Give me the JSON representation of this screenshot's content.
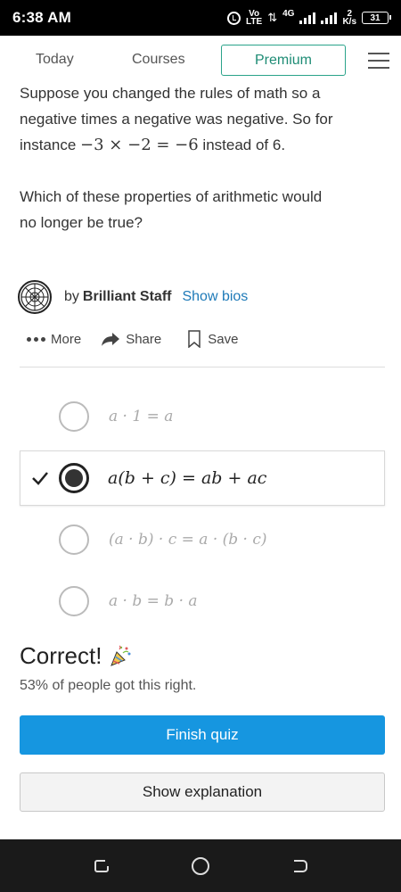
{
  "status_bar": {
    "time": "6:38 AM",
    "network_top": "Vo",
    "network_bottom": "LTE",
    "signal_type": "4G",
    "speed_value": "2",
    "speed_unit": "K/s",
    "battery": "31"
  },
  "nav": {
    "tabs": [
      "Today",
      "Courses"
    ],
    "premium_label": "Premium"
  },
  "question": {
    "line1": "Suppose you changed the rules of math so a",
    "line2": "negative times a negative was negative. So for",
    "line3_prefix": "instance ",
    "line3_math": "−3 × −2 = −6",
    "line3_suffix": " instead of 6.",
    "prompt_line1": "Which of these properties of arithmetic would",
    "prompt_line2": "no longer be true?"
  },
  "author": {
    "by_label": "by",
    "name": "Brilliant Staff",
    "bios_link": "Show bios"
  },
  "actions": {
    "more": "More",
    "share": "Share",
    "save": "Save"
  },
  "options": [
    {
      "text": "a · 1 = a",
      "selected": false
    },
    {
      "text": "a(b + c) = ab + ac",
      "selected": true
    },
    {
      "text": "(a · b) · c = a · (b · c)",
      "selected": false
    },
    {
      "text": "a · b = b · a",
      "selected": false
    }
  ],
  "result": {
    "title": "Correct!",
    "stat": "53% of people got this right."
  },
  "buttons": {
    "finish": "Finish quiz",
    "explanation": "Show explanation"
  },
  "colors": {
    "accent_blue": "#1696e0",
    "premium_green": "#1e8c75",
    "link_blue": "#1e7ab8"
  }
}
